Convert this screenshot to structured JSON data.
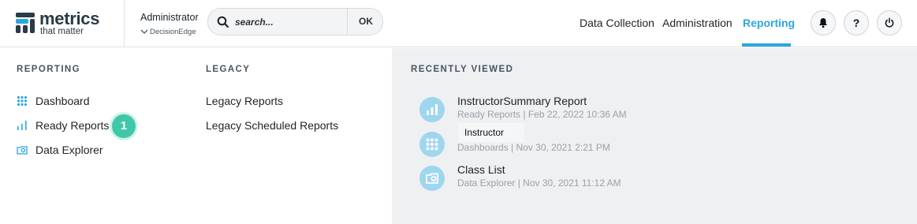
{
  "brand": {
    "name": "metrics",
    "tagline": "that matter",
    "logo_icon": "metrics-logo-icon"
  },
  "user": {
    "name": "Administrator",
    "org": "DecisionEdge"
  },
  "search": {
    "placeholder": "search...",
    "button_label": "OK"
  },
  "nav": {
    "items": [
      {
        "label": "Data Collection",
        "active": false
      },
      {
        "label": "Administration",
        "active": false
      },
      {
        "label": "Reporting",
        "active": true
      }
    ]
  },
  "header_actions": [
    {
      "name": "notifications",
      "icon": "bell-icon"
    },
    {
      "name": "help",
      "label": "?",
      "icon": "help-icon"
    },
    {
      "name": "logout",
      "icon": "power-icon"
    }
  ],
  "reporting": {
    "title": "REPORTING",
    "items": [
      {
        "label": "Dashboard",
        "icon": "grid-icon"
      },
      {
        "label": "Ready Reports",
        "icon": "bar-chart-icon",
        "badge": "1"
      },
      {
        "label": "Data Explorer",
        "icon": "explorer-icon"
      }
    ]
  },
  "legacy": {
    "title": "LEGACY",
    "items": [
      {
        "label": "Legacy Reports"
      },
      {
        "label": "Legacy Scheduled Reports"
      }
    ]
  },
  "recent": {
    "title": "RECENTLY VIEWED",
    "items": [
      {
        "title": "InstructorSummary Report",
        "meta": "Ready Reports | Feb 22, 2022 10:36 AM",
        "icon": "bar-chart-icon"
      },
      {
        "title": "Instructor",
        "meta": "Dashboards | Nov 30, 2021 2:21 PM",
        "icon": "grid-icon"
      },
      {
        "title": "Class List",
        "meta": "Data Explorer | Nov 30, 2021 11:12 AM",
        "icon": "explorer-icon"
      }
    ]
  },
  "colors": {
    "accent": "#2aa7e0",
    "badge": "#3fc8a8",
    "panel_bg": "#eef0f2",
    "recent_icon_bg": "#9fd6ef"
  }
}
